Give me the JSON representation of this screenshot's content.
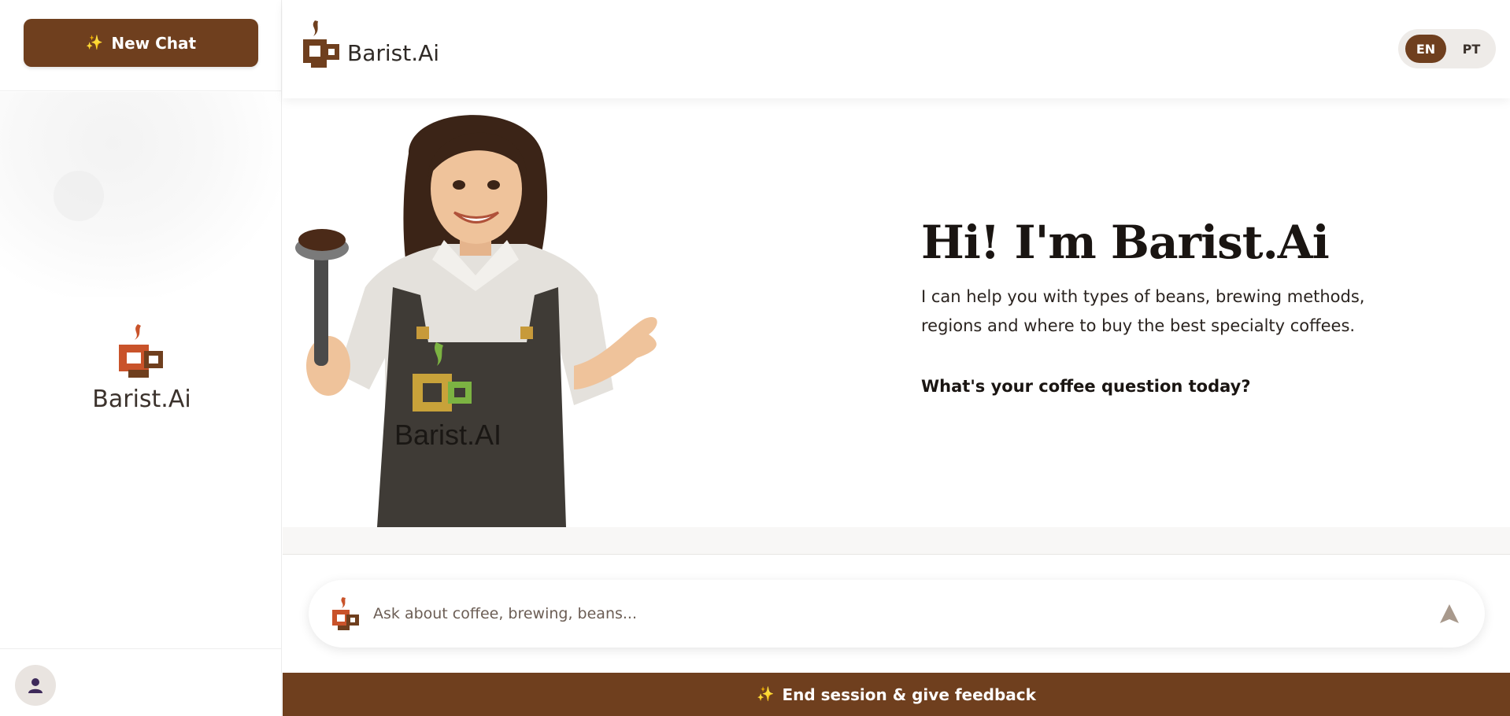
{
  "sidebar": {
    "new_chat_label": "New Chat",
    "new_chat_icon": "sparkles-icon",
    "brand_name": "Barist.Ai",
    "avatar_icon": "user-icon"
  },
  "header": {
    "brand_name": "Barist.Ai",
    "languages": [
      "EN",
      "PT"
    ],
    "active_language": "EN"
  },
  "hero": {
    "title": "Hi! I'm Barist.Ai",
    "description": "I can help you with types of beans, brewing methods, regions and where to buy the best specialty coffees.",
    "question": "What's your coffee question today?",
    "apron_text": "Barist.AI"
  },
  "composer": {
    "placeholder": "Ask about coffee, brewing, beans...",
    "send_icon": "send-arrow-icon"
  },
  "footer": {
    "feedback_label": "End session & give feedback"
  },
  "colors": {
    "brand_brown": "#6f3f1e",
    "logo_orange": "#c9532a",
    "accent_gold": "#f2b84b"
  }
}
